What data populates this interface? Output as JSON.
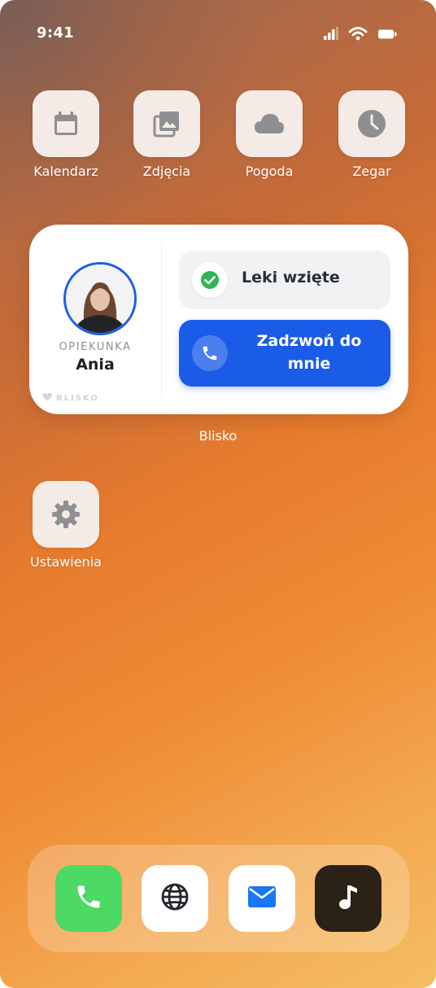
{
  "status_bar": {
    "time": "9:41",
    "icons": [
      "signal-icon",
      "wifi-icon",
      "battery-icon"
    ]
  },
  "apps": [
    {
      "label": "Kalendarz",
      "icon": "calendar-icon"
    },
    {
      "label": "Zdjęcia",
      "icon": "photos-icon"
    },
    {
      "label": "Pogoda",
      "icon": "cloud-icon"
    },
    {
      "label": "Zegar",
      "icon": "clock-icon"
    },
    {
      "label": "Ustawienia",
      "icon": "gear-icon"
    }
  ],
  "widget": {
    "role": "OPIEKUNKA",
    "name": "Ania",
    "brand": "BLISKO",
    "meds_label": "Leki wzięte",
    "call_label": "Zadzwoń do mnie",
    "caption": "Blisko",
    "accent": "#1a5ce8",
    "check_color": "#2fb457"
  },
  "dock": [
    {
      "icon": "phone-icon",
      "color": "#4cd964"
    },
    {
      "icon": "globe-icon",
      "color": "#ffffff"
    },
    {
      "icon": "mail-icon",
      "color": "#ffffff"
    },
    {
      "icon": "music-icon",
      "color": "#2c2117"
    }
  ]
}
